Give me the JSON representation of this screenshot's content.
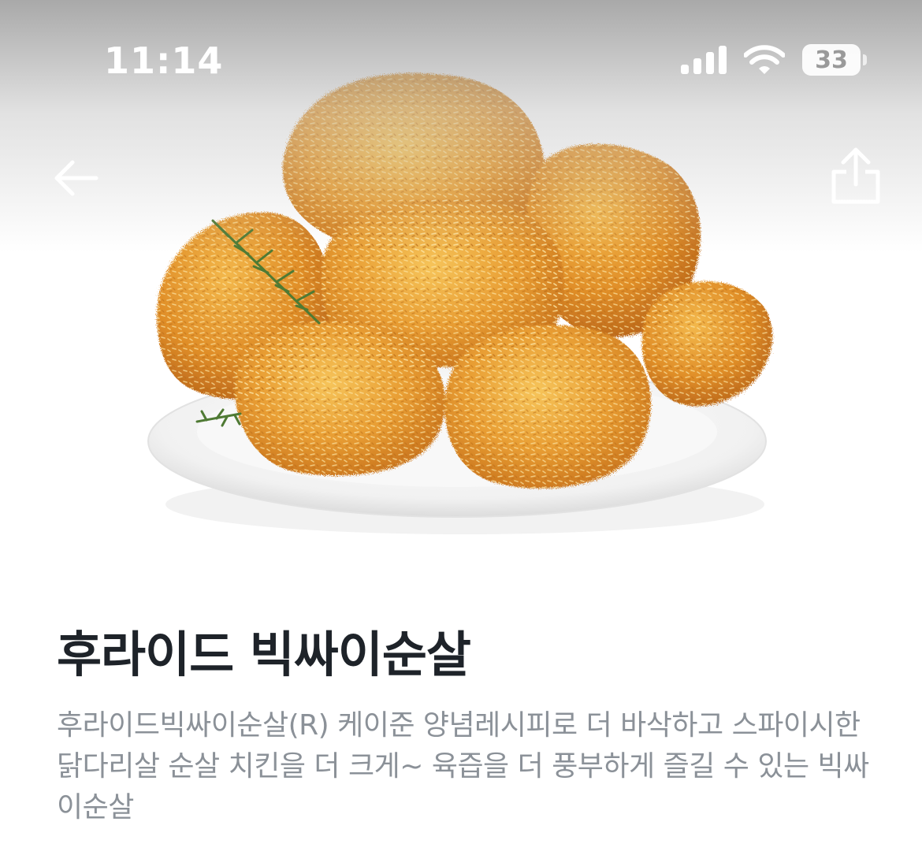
{
  "status_bar": {
    "time": "11:14",
    "battery": "33",
    "icons": [
      "cellular-signal-icon",
      "wifi-icon",
      "battery-icon"
    ]
  },
  "nav": {
    "back_icon": "arrow-left-icon",
    "share_icon": "share-icon"
  },
  "product": {
    "image_subject": "fried-chicken",
    "title": "후라이드 빅싸이순살",
    "description": "후라이드빅싸이순살(R) 케이준 양념레시피로 더 바삭하고 스파이시한 닭다리살 순살 치킨을 더 크게~ 육즙을 더 풍부하게 즐길 수 있는 빅싸이순살"
  },
  "colors": {
    "title": "#1e2329",
    "description": "#8b9198",
    "chicken": "#e59a2c",
    "plate": "#f4f4f4"
  }
}
